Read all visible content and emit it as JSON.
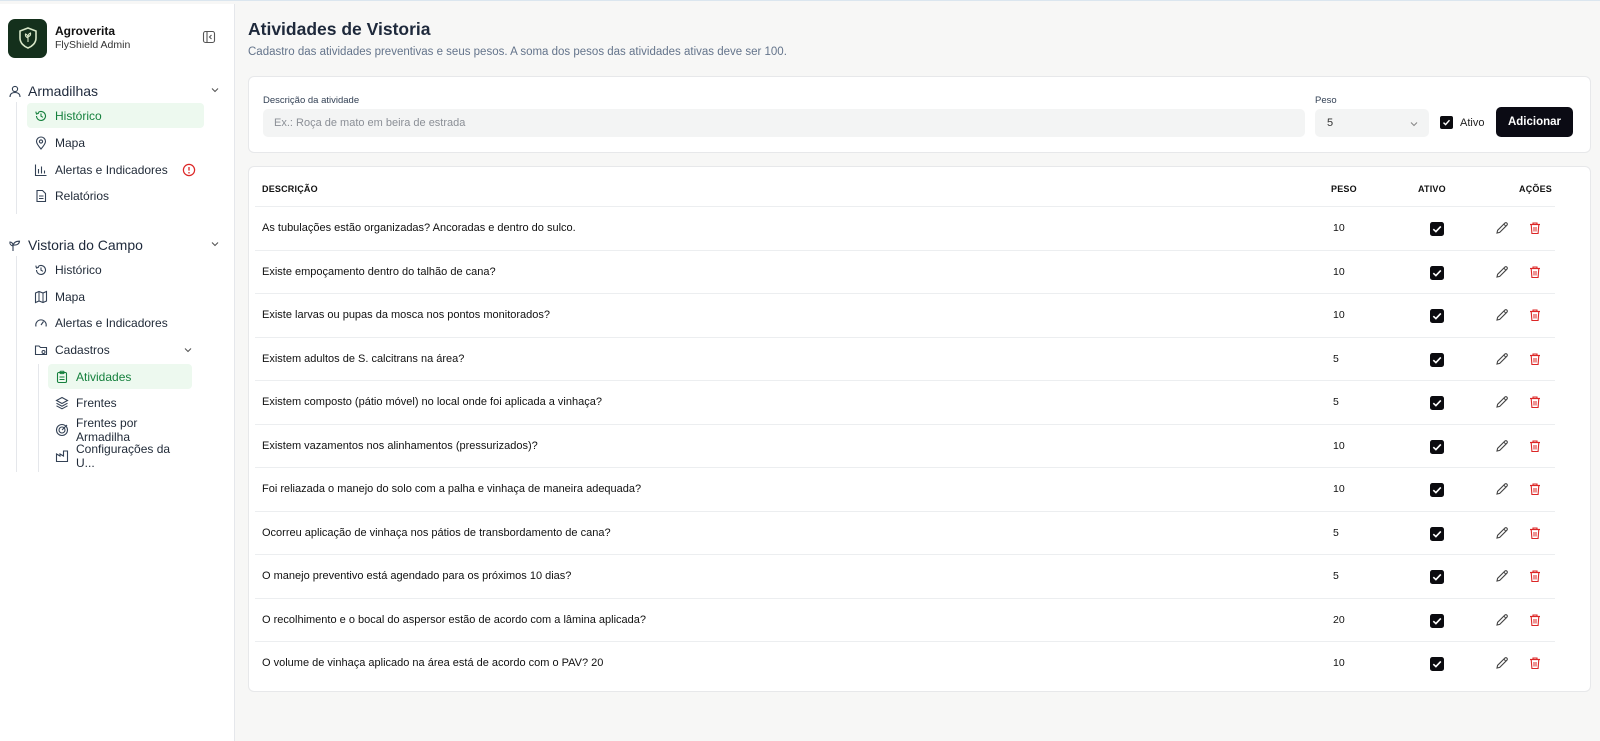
{
  "brand": {
    "name": "Agroverita",
    "subtitle": "FlyShield Admin"
  },
  "sidebar": {
    "groups": [
      {
        "label": "Armadilhas",
        "items": [
          {
            "label": "Histórico",
            "active": true
          },
          {
            "label": "Mapa"
          },
          {
            "label": "Alertas e Indicadores",
            "alert": true
          },
          {
            "label": "Relatórios"
          }
        ]
      },
      {
        "label": "Vistoria do Campo",
        "items": [
          {
            "label": "Histórico"
          },
          {
            "label": "Mapa"
          },
          {
            "label": "Alertas e Indicadores"
          },
          {
            "label": "Cadastros"
          }
        ],
        "subitems": [
          {
            "label": "Atividades",
            "active": true
          },
          {
            "label": "Frentes"
          },
          {
            "label": "Frentes por Armadilha"
          },
          {
            "label": "Configurações da U..."
          }
        ]
      }
    ]
  },
  "page": {
    "title": "Atividades de Vistoria",
    "subtitle": "Cadastro das atividades preventivas e seus pesos. A soma dos pesos das atividades ativas deve ser 100."
  },
  "form": {
    "desc_label": "Descrição da atividade",
    "desc_placeholder": "Ex.: Roça de mato em beira de estrada",
    "peso_label": "Peso",
    "peso_value": "5",
    "ativo_label": "Ativo",
    "ativo_checked": true,
    "add_label": "Adicionar"
  },
  "table": {
    "headers": {
      "descricao": "DESCRIÇÃO",
      "peso": "PESO",
      "ativo": "ATIVO",
      "acoes": "AÇÕES"
    },
    "rows": [
      {
        "descricao": "As tubulações estão organizadas? Ancoradas e dentro do sulco.",
        "peso": "10",
        "ativo": true
      },
      {
        "descricao": "Existe empoçamento dentro do talhão de cana?",
        "peso": "10",
        "ativo": true
      },
      {
        "descricao": "Existe larvas ou pupas da mosca nos pontos monitorados?",
        "peso": "10",
        "ativo": true
      },
      {
        "descricao": "Existem adultos de S. calcitrans na área?",
        "peso": "5",
        "ativo": true
      },
      {
        "descricao": "Existem composto (pátio móvel) no local onde foi aplicada a vinhaça?",
        "peso": "5",
        "ativo": true
      },
      {
        "descricao": "Existem vazamentos nos alinhamentos (pressurizados)?",
        "peso": "10",
        "ativo": true
      },
      {
        "descricao": "Foi reliazada o manejo do solo com a palha e vinhaça de maneira adequada?",
        "peso": "10",
        "ativo": true
      },
      {
        "descricao": "Ocorreu aplicação de vinhaça nos pátios de transbordamento de cana?",
        "peso": "5",
        "ativo": true
      },
      {
        "descricao": "O manejo preventivo está agendado para os próximos 10 dias?",
        "peso": "5",
        "ativo": true
      },
      {
        "descricao": "O recolhimento e o bocal do aspersor estão de acordo com a lâmina aplicada?",
        "peso": "20",
        "ativo": true
      },
      {
        "descricao": "O volume de vinhaça aplicado na área está de acordo com o PAV? 20",
        "peso": "10",
        "ativo": true
      }
    ]
  },
  "colors": {
    "accent_green": "#15803d",
    "active_bg": "#edf9ef",
    "danger": "#dc2626",
    "primary_dark": "#0b0b14"
  }
}
